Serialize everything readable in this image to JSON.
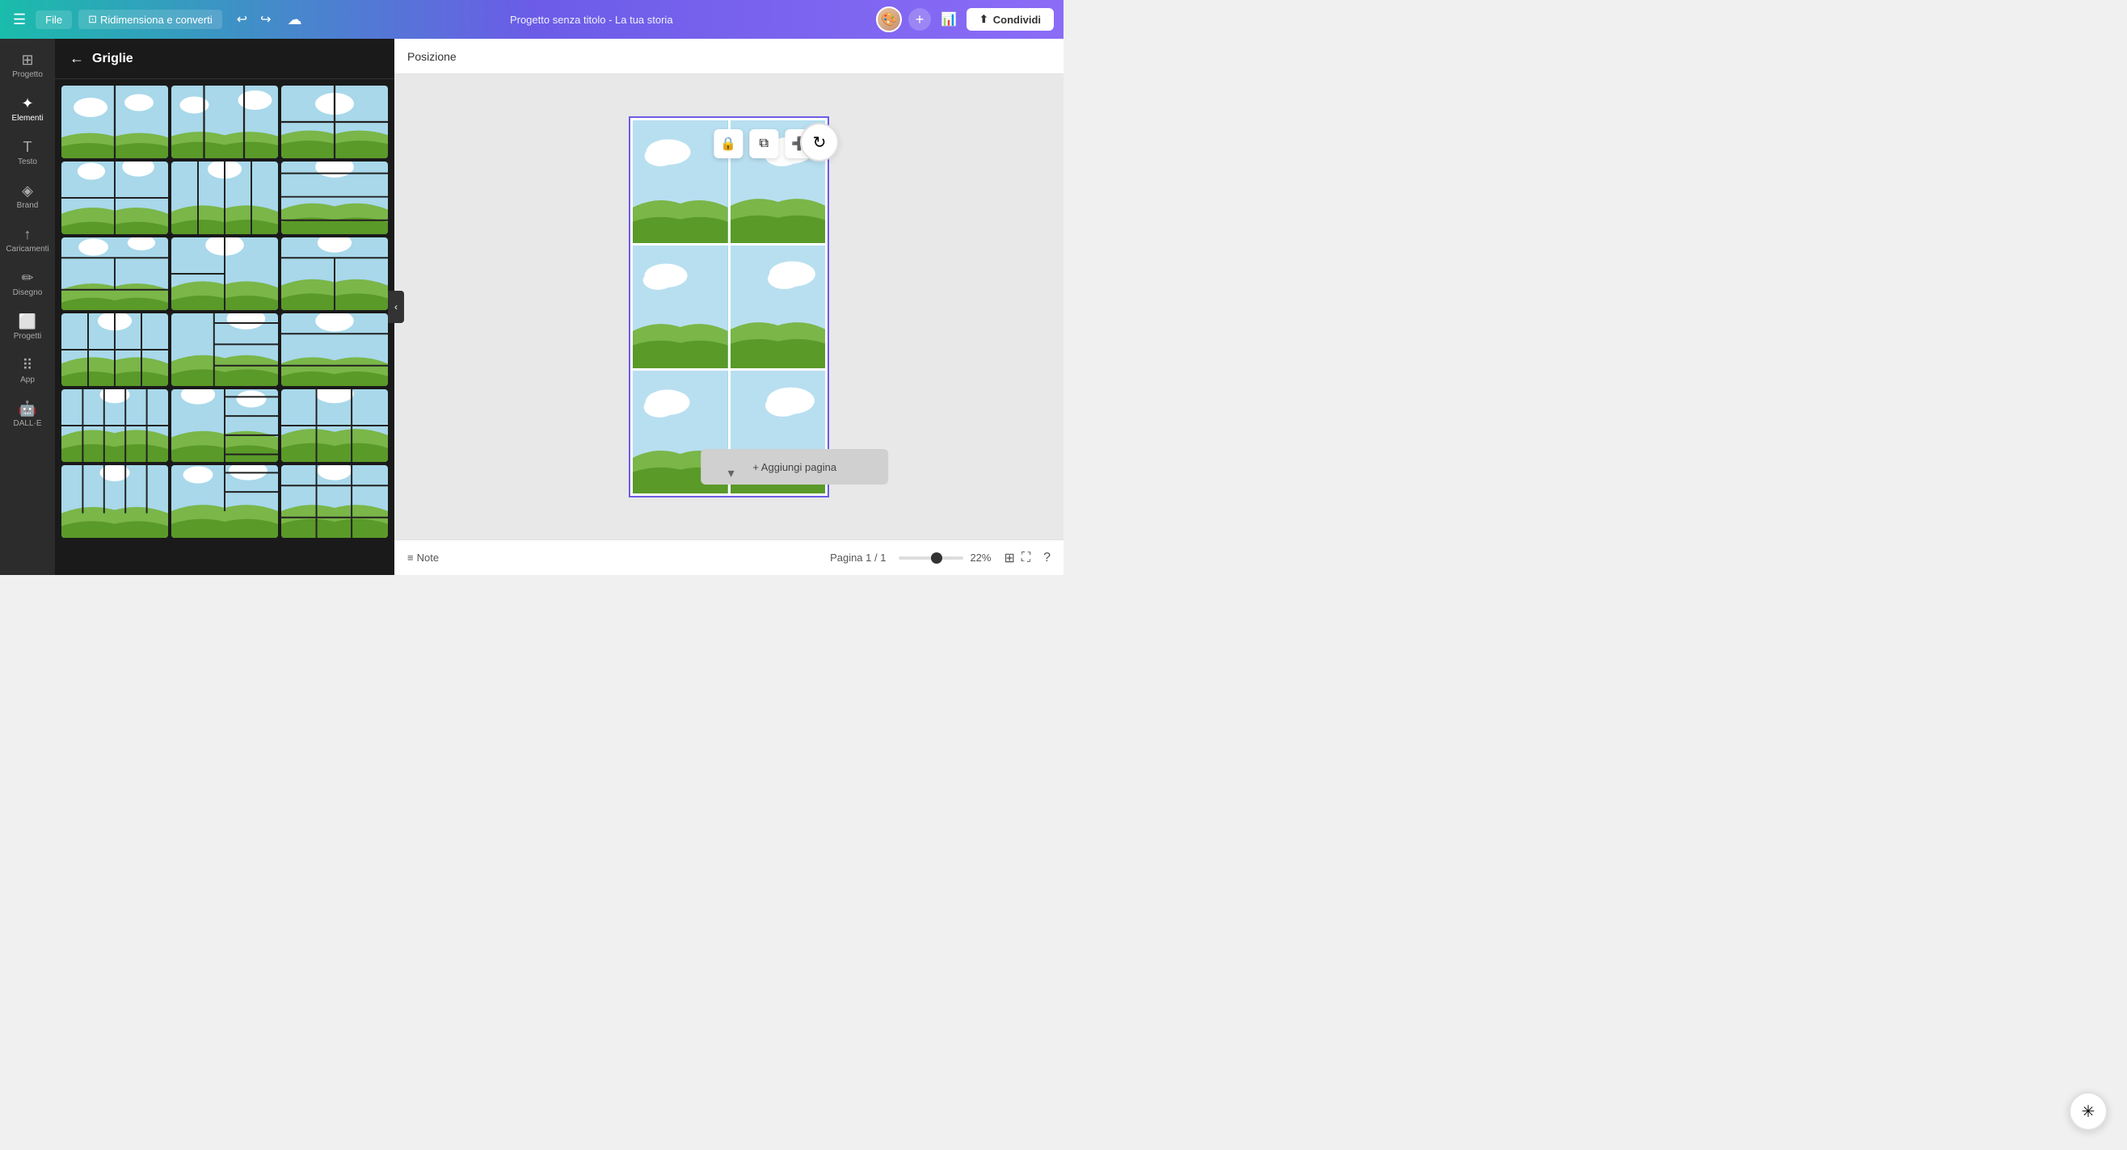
{
  "topbar": {
    "file_label": "File",
    "resize_label": "Ridimensiona e converti",
    "title": "Progetto senza titolo - La tua storia",
    "share_label": "Condividi"
  },
  "sidebar": {
    "items": [
      {
        "id": "progetto",
        "label": "Progetto",
        "icon": "⊞"
      },
      {
        "id": "elementi",
        "label": "Elementi",
        "icon": "✦",
        "active": true
      },
      {
        "id": "testo",
        "label": "Testo",
        "icon": "T"
      },
      {
        "id": "brand",
        "label": "Brand",
        "icon": "◈"
      },
      {
        "id": "caricamenti",
        "label": "Caricamenti",
        "icon": "↑"
      },
      {
        "id": "disegno",
        "label": "Disegno",
        "icon": "✏"
      },
      {
        "id": "progetti",
        "label": "Progetti",
        "icon": "⬜"
      },
      {
        "id": "app",
        "label": "App",
        "icon": "⠿"
      },
      {
        "id": "dalle",
        "label": "DALL·E",
        "icon": "🤖"
      }
    ]
  },
  "panel": {
    "title": "Griglie",
    "back_label": "←"
  },
  "canvas": {
    "toolbar_label": "Posizione",
    "add_page_label": "+ Aggiungi pagina"
  },
  "bottombar": {
    "notes_label": "Note",
    "page_info": "Pagina 1 / 1",
    "zoom_level": "22%"
  },
  "icons": {
    "lock": "🔒",
    "copy": "⧉",
    "add": "➕",
    "refresh": "↻",
    "chevron_left": "‹",
    "undo": "↩",
    "redo": "↪",
    "cloud": "☁",
    "share_icon": "⬆",
    "notes_icon": "≡",
    "grid_view": "⊞",
    "fullscreen": "⛶",
    "help": "?",
    "magic": "✳",
    "show_pages": "▾",
    "hide_panel": "‹"
  }
}
